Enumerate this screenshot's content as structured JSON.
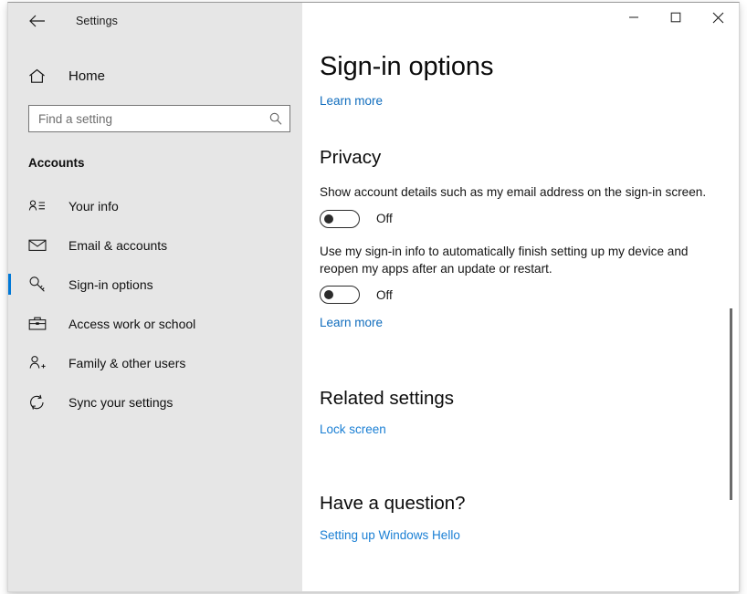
{
  "window": {
    "app_title": "Settings",
    "back_icon": "back-arrow-icon",
    "controls": {
      "minimize_label": "Minimize",
      "maximize_label": "Maximize",
      "close_label": "Close"
    }
  },
  "sidebar": {
    "home": {
      "label": "Home",
      "icon": "home-icon"
    },
    "search": {
      "placeholder": "Find a setting",
      "value": "",
      "icon": "search-icon"
    },
    "category": "Accounts",
    "items": [
      {
        "label": "Your info",
        "icon": "contact-card-icon",
        "selected": false
      },
      {
        "label": "Email & accounts",
        "icon": "envelope-icon",
        "selected": false
      },
      {
        "label": "Sign-in options",
        "icon": "key-icon",
        "selected": true
      },
      {
        "label": "Access work or school",
        "icon": "briefcase-icon",
        "selected": false
      },
      {
        "label": "Family & other users",
        "icon": "person-add-icon",
        "selected": false
      },
      {
        "label": "Sync your settings",
        "icon": "sync-refresh-icon",
        "selected": false
      }
    ]
  },
  "main": {
    "page_title": "Sign-in options",
    "top_learn_more": "Learn more",
    "privacy": {
      "heading": "Privacy",
      "setting_1": {
        "description": "Show account details such as my email address on the sign-in screen.",
        "state": "Off",
        "is_on": false
      },
      "setting_2": {
        "description": "Use my sign-in info to automatically finish setting up my device and reopen my apps after an update or restart.",
        "state": "Off",
        "is_on": false
      },
      "learn_more": "Learn more"
    },
    "related_settings": {
      "heading": "Related settings",
      "links": [
        "Lock screen"
      ]
    },
    "have_a_question": {
      "heading": "Have a question?",
      "links": [
        "Setting up Windows Hello"
      ]
    }
  },
  "colors": {
    "accent": "#0078d7",
    "link": "#0f6cbd",
    "sidebar_bg": "#e6e6e6",
    "content_bg": "#ffffff"
  }
}
